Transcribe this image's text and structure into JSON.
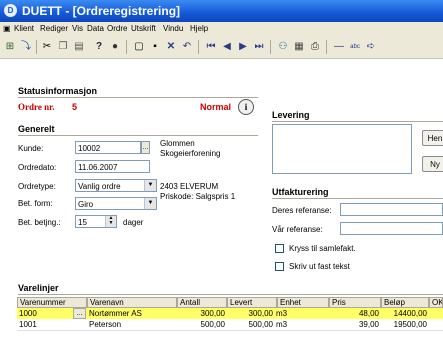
{
  "window": {
    "title": "DUETT - [Ordreregistrering]",
    "icon": "duett-app-icon"
  },
  "menu": [
    "Klient",
    "Rediger",
    "Vis",
    "Data",
    "Ordre",
    "Utskrift",
    "Vindu",
    "Hjelp"
  ],
  "status": {
    "header": "Statusinformasjon",
    "order_label": "Ordre nr.",
    "order_number": "5",
    "priority": "Normal"
  },
  "general": {
    "header": "Generelt",
    "customer_label": "Kunde:",
    "customer_number": "10002",
    "customer_name": "Glommen Skogeierforening",
    "order_date_label": "Ordredato:",
    "order_date": "11.06.2007",
    "order_type_label": "Ordretype:",
    "order_type": "Vanlig ordre",
    "address_line": "2403 ELVERUM",
    "price_code": "Priskode: Salgspris 1",
    "payment_form_label": "Bet. form:",
    "payment_form": "Giro",
    "payment_terms_label": "Bet. betjng.:",
    "payment_terms": "15",
    "days_label": "dager"
  },
  "delivery": {
    "header": "Levering",
    "fetch_button": "Hen",
    "new_button": "Ny"
  },
  "invoicing": {
    "header": "Utfakturering",
    "your_ref_label": "Deres referanse:",
    "your_ref": "",
    "our_ref_label": "Vår referanse:",
    "our_ref": "",
    "collective_invoice_label": "Kryss til samlefakt.",
    "print_fixed_text_label": "Skriv ut fast tekst"
  },
  "items": {
    "header": "Varelinjer",
    "columns": [
      "Varenummer",
      "Varenavn",
      "Antall",
      "Levert",
      "Enhet",
      "Pris",
      "Beløp",
      "OK"
    ],
    "rows": [
      {
        "item_no": "1000",
        "name": "Nortømmer AS",
        "qty": "300,00",
        "delivered": "300,00",
        "unit": "m3",
        "price": "48,00",
        "amount": "14400,00",
        "ok": ""
      },
      {
        "item_no": "1001",
        "name": "Peterson",
        "qty": "500,00",
        "delivered": "500,00",
        "unit": "m3",
        "price": "39,00",
        "amount": "19500,00",
        "ok": ""
      }
    ]
  },
  "colors": {
    "title_bar": "#1458d8",
    "order_red": "#cc0000",
    "selected_row": "#ffff66"
  }
}
